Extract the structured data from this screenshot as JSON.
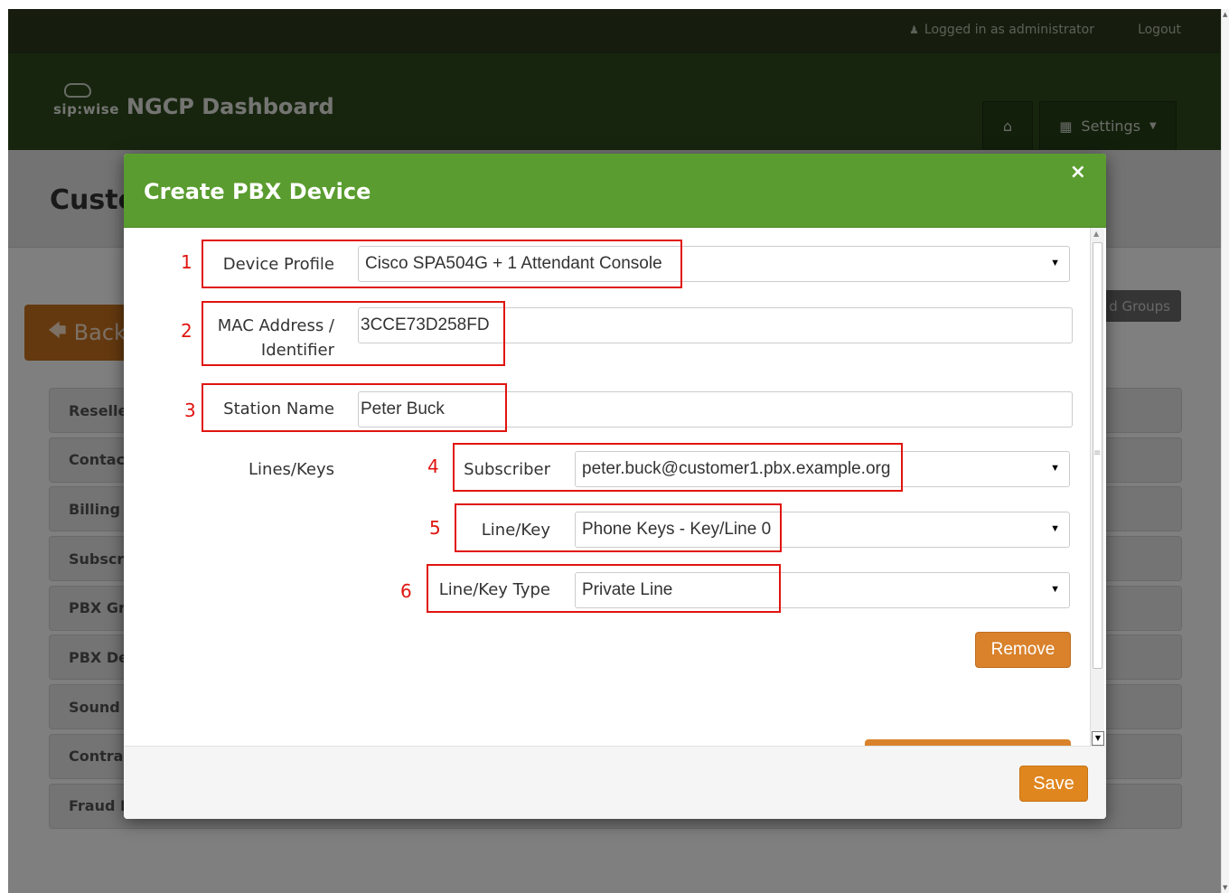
{
  "topbar": {
    "logged_in": "Logged in as administrator",
    "logout": "Logout",
    "user_icon": "user-icon"
  },
  "header": {
    "logo_text": "sip:wise",
    "app_title": "NGCP Dashboard",
    "home_icon": "home-icon",
    "settings_label": "Settings"
  },
  "background": {
    "page_title": "Custo",
    "back_label": "Back",
    "groups_label": "d Groups",
    "sections": [
      "Reseller",
      "Contact",
      "Billing I",
      "Subscri",
      "PBX Gr",
      "PBX De",
      "Sound S",
      "Contrac",
      "Fraud L"
    ]
  },
  "modal": {
    "title": "Create PBX Device",
    "close_symbol": "×",
    "device_profile": {
      "label": "Device Profile",
      "value": "Cisco SPA504G + 1 Attendant Console"
    },
    "mac_address": {
      "label_line1": "MAC Address /",
      "label_line2": "Identifier",
      "value": "3CCE73D258FD"
    },
    "station_name": {
      "label": "Station Name",
      "value": "Peter Buck"
    },
    "lines_keys_label": "Lines/Keys",
    "subscriber": {
      "label": "Subscriber",
      "value": "peter.buck@customer1.pbx.example.org"
    },
    "line_key": {
      "label": "Line/Key",
      "value": "Phone Keys - Key/Line 0"
    },
    "line_key_type": {
      "label": "Line/Key Type",
      "value": "Private Line"
    },
    "remove_label": "Remove",
    "save_label": "Save"
  },
  "annotations": [
    "1",
    "2",
    "3",
    "4",
    "5",
    "6"
  ],
  "colors": {
    "modal_header": "#5a9c2f",
    "header_bg": "#2e4a1e",
    "topbar_bg": "#2c3a1e",
    "orange_button": "#d9822b",
    "annotation_red": "#e0140f"
  }
}
